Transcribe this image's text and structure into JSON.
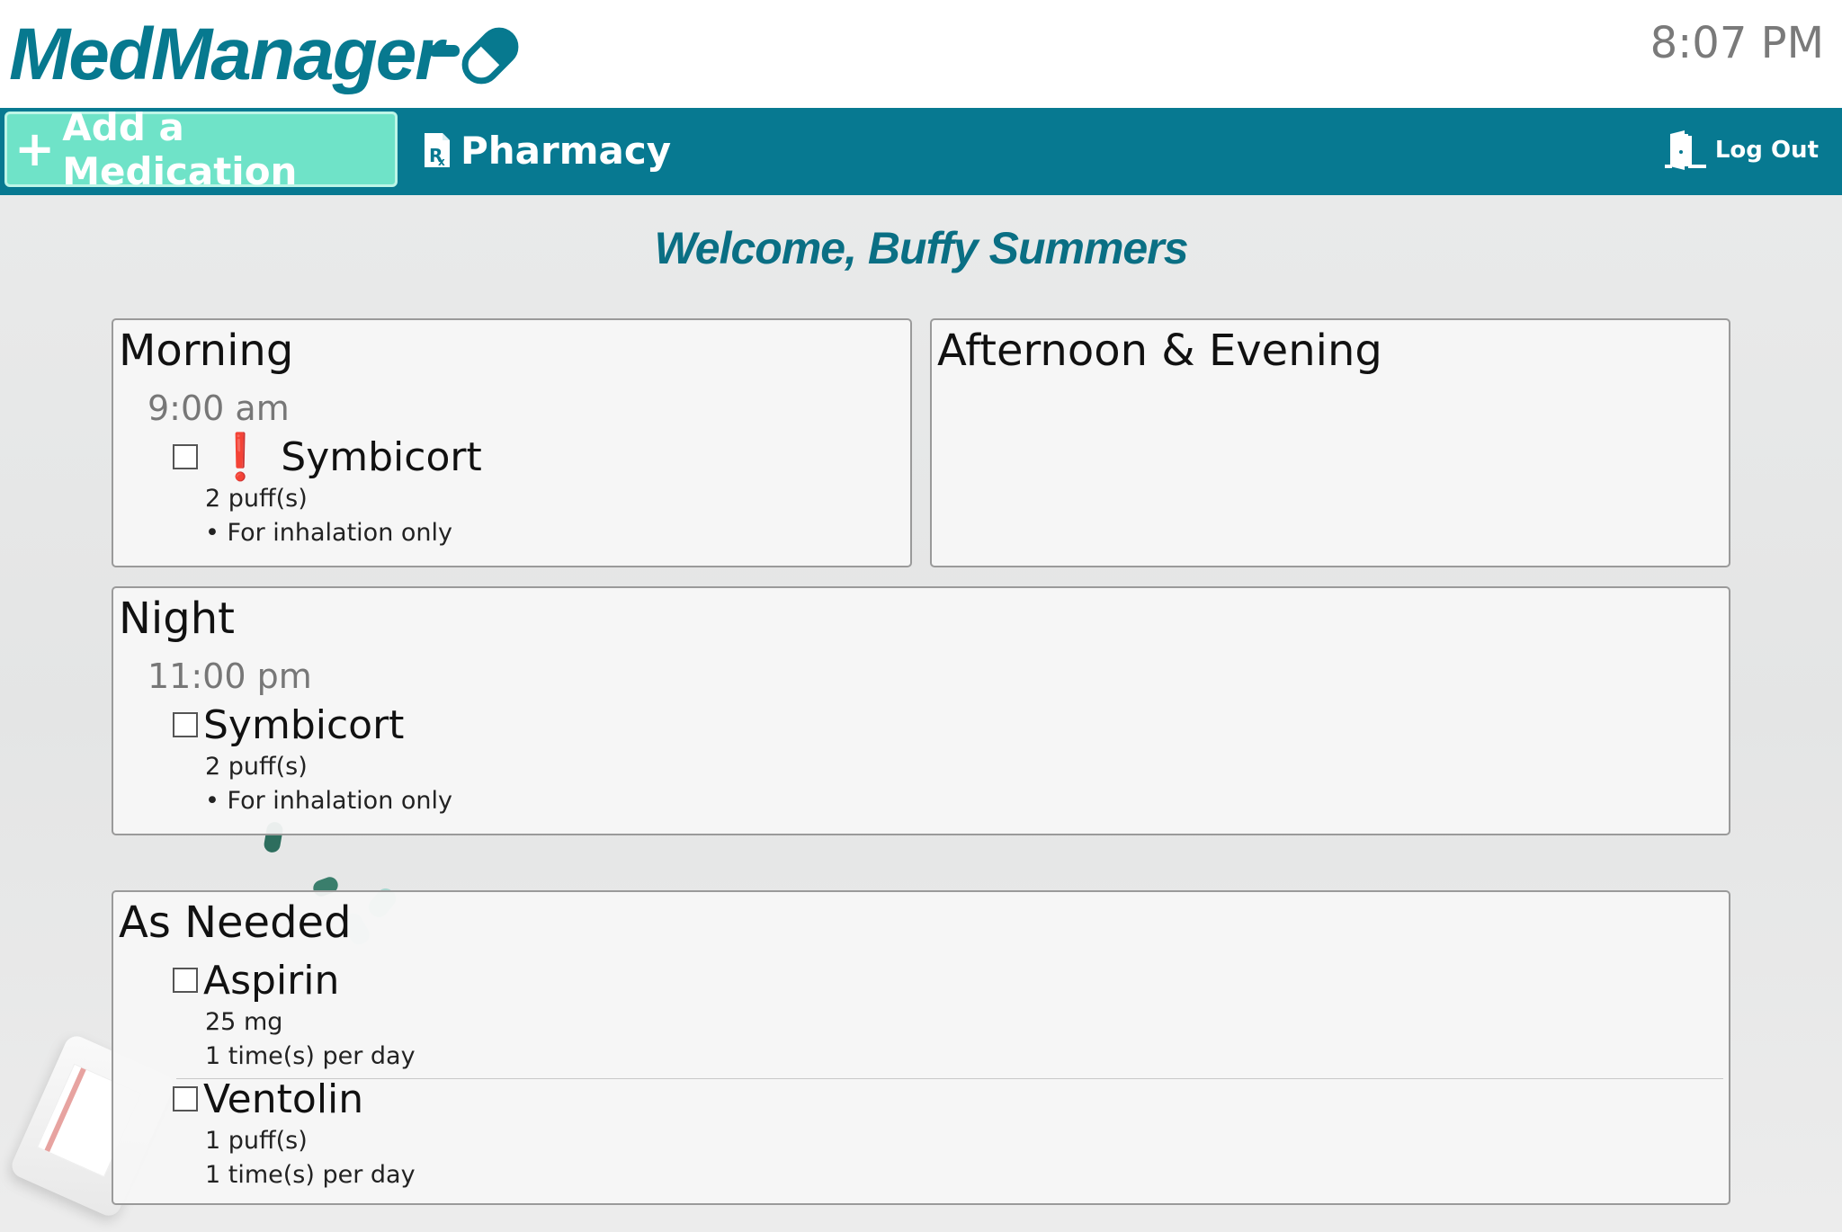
{
  "app": {
    "title": "MedManager",
    "clock": "8:07 PM"
  },
  "nav": {
    "add_medication": "Add a Medication",
    "pharmacy": "Pharmacy",
    "logout": "Log Out"
  },
  "welcome": "Welcome, Buffy Summers",
  "schedule": {
    "morning": {
      "title": "Morning",
      "time": "9:00 am",
      "meds": [
        {
          "name": "Symbicort",
          "alert": "❗",
          "dose": "2 puff(s)",
          "note": "• For inhalation only"
        }
      ]
    },
    "afternoon": {
      "title": "Afternoon & Evening"
    },
    "night": {
      "title": "Night",
      "time": "11:00 pm",
      "meds": [
        {
          "name": "Symbicort",
          "dose": "2 puff(s)",
          "note": "• For inhalation only"
        }
      ]
    },
    "as_needed": {
      "title": "As Needed",
      "meds": [
        {
          "name": "Aspirin",
          "dose": "25 mg",
          "frequency": "1 time(s) per day"
        },
        {
          "name": "Ventolin",
          "dose": "1 puff(s)",
          "frequency": "1 time(s) per day"
        }
      ]
    }
  },
  "colors": {
    "brand": "#07798f",
    "accent": "#6fe3c8",
    "alert": "#e60d0d"
  },
  "icons": [
    "pill-icon",
    "plus-icon",
    "prescription-icon",
    "door-icon",
    "exclamation-icon"
  ]
}
